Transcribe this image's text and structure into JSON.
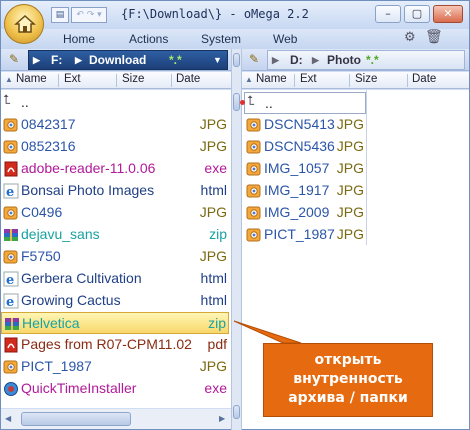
{
  "window": {
    "title": "{F:\\Download\\} - oMega 2.2"
  },
  "menu": [
    "Home",
    "Actions",
    "System",
    "Web"
  ],
  "left_panel": {
    "drive": "F:",
    "folder": "Download",
    "mask": "*.*",
    "columns": [
      "Name",
      "Ext",
      "Size",
      "Date"
    ],
    "parent": "..",
    "rows": [
      {
        "name": "0842317",
        "ext": "JPG",
        "color": "#2b55a8",
        "ext_color": "#7a6a12",
        "icon": "image-icon"
      },
      {
        "name": "0852316",
        "ext": "JPG",
        "color": "#2b55a8",
        "ext_color": "#7a6a12",
        "icon": "image-icon"
      },
      {
        "name": "adobe-reader-11.0.06",
        "ext": "exe",
        "color": "#b11a9a",
        "ext_color": "#b11a9a",
        "icon": "pdf-icon"
      },
      {
        "name": "Bonsai Photo Images",
        "ext": "html",
        "color": "#1f3f86",
        "ext_color": "#1f3f86",
        "icon": "ie-icon"
      },
      {
        "name": "C0496",
        "ext": "JPG",
        "color": "#2b55a8",
        "ext_color": "#7a6a12",
        "icon": "image-icon"
      },
      {
        "name": "dejavu_sans",
        "ext": "zip",
        "color": "#18a3a0",
        "ext_color": "#18a3a0",
        "icon": "archive-icon"
      },
      {
        "name": "F5750",
        "ext": "JPG",
        "color": "#2b55a8",
        "ext_color": "#7a6a12",
        "icon": "image-icon"
      },
      {
        "name": "Gerbera Cultivation",
        "ext": "html",
        "color": "#1f3f86",
        "ext_color": "#1f3f86",
        "icon": "ie-icon"
      },
      {
        "name": "Growing Cactus",
        "ext": "html",
        "color": "#1f3f86",
        "ext_color": "#1f3f86",
        "icon": "ie-icon"
      },
      {
        "name": "Helvetica",
        "ext": "zip",
        "color": "#18a3a0",
        "ext_color": "#18a3a0",
        "icon": "archive-icon",
        "selected": true
      },
      {
        "name": "Pages from R07-CPM11.02",
        "ext": "pdf",
        "color": "#8a2b12",
        "ext_color": "#8a2b12",
        "icon": "pdf-icon"
      },
      {
        "name": "PICT_1987",
        "ext": "JPG",
        "color": "#2b55a8",
        "ext_color": "#7a6a12",
        "icon": "image-icon"
      },
      {
        "name": "QuickTimeInstaller",
        "ext": "exe",
        "color": "#b11a9a",
        "ext_color": "#b11a9a",
        "icon": "quicktime-icon"
      }
    ]
  },
  "right_panel": {
    "drive": "D:",
    "folder": "Photo",
    "mask": "*.*",
    "columns": [
      "Name",
      "Ext",
      "Size",
      "Date"
    ],
    "parent": "..",
    "rows": [
      {
        "name": "DSCN5413",
        "ext": "JPG",
        "color": "#2b55a8",
        "ext_color": "#7a6a12",
        "icon": "image-icon"
      },
      {
        "name": "DSCN5436",
        "ext": "JPG",
        "color": "#2b55a8",
        "ext_color": "#7a6a12",
        "icon": "image-icon"
      },
      {
        "name": "IMG_1057",
        "ext": "JPG",
        "color": "#2b55a8",
        "ext_color": "#7a6a12",
        "icon": "image-icon"
      },
      {
        "name": "IMG_1917",
        "ext": "JPG",
        "color": "#2b55a8",
        "ext_color": "#7a6a12",
        "icon": "image-icon"
      },
      {
        "name": "IMG_2009",
        "ext": "JPG",
        "color": "#2b55a8",
        "ext_color": "#7a6a12",
        "icon": "image-icon"
      },
      {
        "name": "PICT_1987",
        "ext": "JPG",
        "color": "#2b55a8",
        "ext_color": "#7a6a12",
        "icon": "image-icon"
      }
    ]
  },
  "callout": {
    "text": "открыть\nвнутренность\nархива / папки"
  }
}
